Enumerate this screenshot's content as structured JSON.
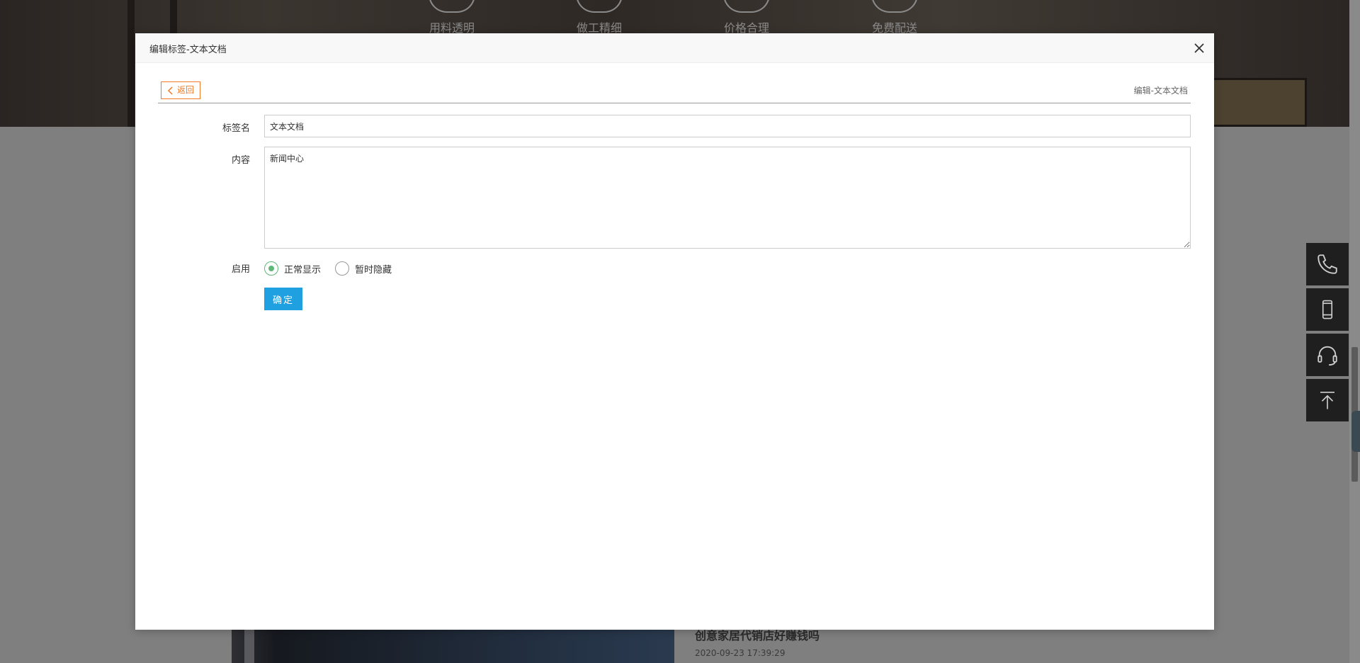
{
  "background": {
    "features": [
      "用料透明",
      "做工精细",
      "价格合理",
      "免费配送"
    ],
    "news": {
      "title": "创意家居代销店好赚钱吗",
      "date": "2020-09-23 17:39:29"
    },
    "float_tools": [
      "phone-icon",
      "mobile-icon",
      "headset-icon",
      "back-to-top-icon"
    ]
  },
  "modal": {
    "title": "编辑标签-文本文档",
    "back_label": "返回",
    "breadcrumb": "编辑-文本文档",
    "form": {
      "name_label": "标签名",
      "name_value": "文本文档",
      "content_label": "内容",
      "content_value": "新闻中心",
      "enable_label": "启用",
      "options": [
        "正常显示",
        "暂时隐藏"
      ],
      "selected_option": "正常显示",
      "submit_label": "确定"
    }
  },
  "colors": {
    "accent_orange": "#f07a2a",
    "submit_blue": "#1fa0e0",
    "radio_green": "#5fb878"
  }
}
